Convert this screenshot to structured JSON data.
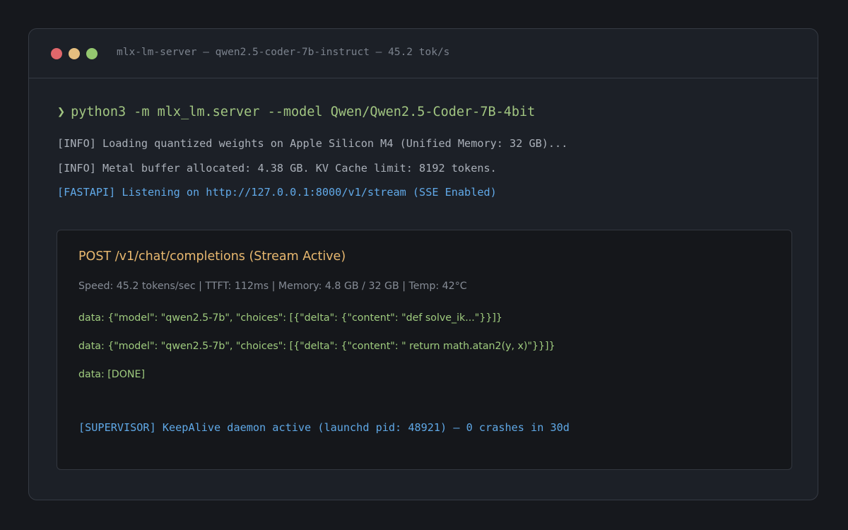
{
  "window": {
    "title": "mlx-lm-server — qwen2.5-coder-7b-instruct — 45.2 tok/s",
    "controls": [
      {
        "name": "close",
        "color": "#e0676b"
      },
      {
        "name": "minimize",
        "color": "#e6bf7f"
      },
      {
        "name": "zoom",
        "color": "#94c76f"
      }
    ]
  },
  "terminal": {
    "prompt_symbol": "❯",
    "command": "python3 -m mlx_lm.server --model Qwen/Qwen2.5-Coder-7B-4bit",
    "logs": [
      "[INFO] Loading quantized weights on Apple Silicon M4 (Unified Memory: 32 GB)...",
      "[INFO] Metal buffer allocated: 4.38 GB. KV Cache limit: 8192 tokens.",
      "[FASTAPI] Listening on http://127.0.0.1:8000/v1/stream (SSE Enabled)"
    ]
  },
  "stream_panel": {
    "title": "POST /v1/chat/completions (Stream Active)",
    "metrics": "Speed: 45.2 tokens/sec | TTFT: 112ms | Memory: 4.8 GB / 32 GB | Temp: 42°C",
    "lines": [
      "data: {\"model\": \"qwen2.5-7b\", \"choices\": [{\"delta\": {\"content\": \"def solve_ik...\"}}]}",
      "data: {\"model\": \"qwen2.5-7b\", \"choices\": [{\"delta\": {\"content\": \" return math.atan2(y, x)\"}}]}",
      "data: [DONE]"
    ],
    "supervisor": "[SUPERVISOR] KeepAlive daemon active (launchd pid: 48921) — 0 crashes in 30d"
  },
  "colors": {
    "background": "#16181d",
    "window": "#1c2027",
    "panel": "#15171b",
    "command": "#a1c581",
    "info": "#aab0b9",
    "link": "#61a9e8",
    "panel_title": "#e8b86f",
    "stream_data": "#9fcb7e"
  }
}
